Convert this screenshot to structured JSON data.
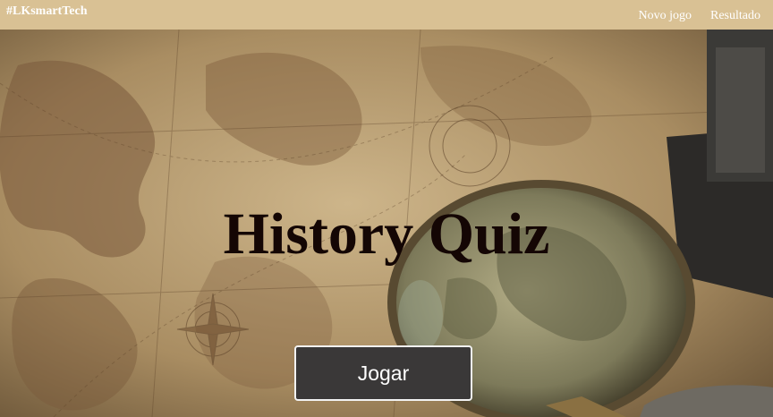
{
  "navbar": {
    "brand": "#LKsmartTech",
    "links": [
      {
        "label": "Novo jogo"
      },
      {
        "label": "Resultado"
      }
    ],
    "background_color": "#d9c194"
  },
  "hero": {
    "title": "History Quiz",
    "play_button_label": "Jogar",
    "background_image": "vintage-map-with-magnifying-glass"
  },
  "colors": {
    "title": "#140604",
    "button_bg": "#3a3838",
    "button_border": "#f2f2f2"
  }
}
